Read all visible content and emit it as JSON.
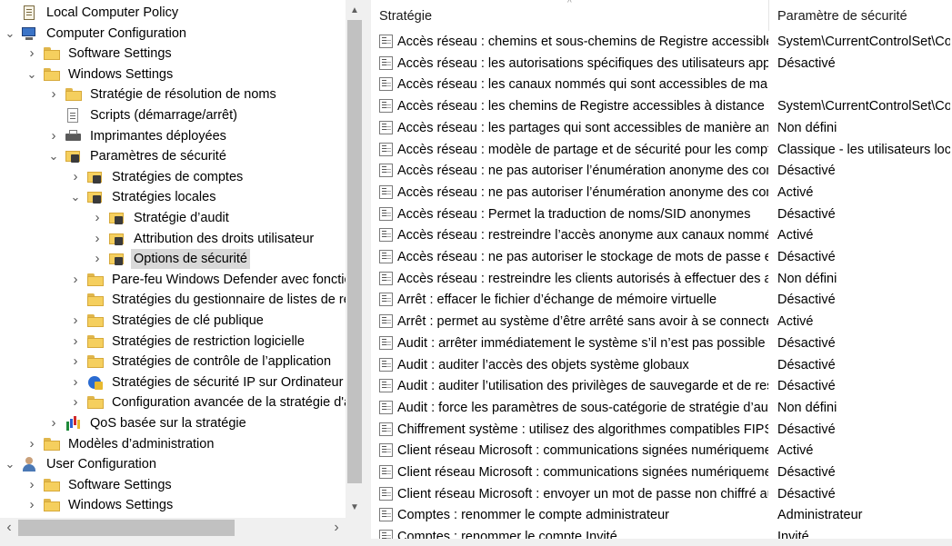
{
  "tree": {
    "nodes": [
      {
        "label": "Local Computer Policy",
        "icon": "policy-icon",
        "level": 0,
        "expander": ""
      },
      {
        "label": "Computer Configuration",
        "icon": "computer-icon",
        "level": 0,
        "expander": "down"
      },
      {
        "label": "Software Settings",
        "icon": "folder-icon",
        "level": 1,
        "expander": "right"
      },
      {
        "label": "Windows Settings",
        "icon": "folder-icon",
        "level": 1,
        "expander": "down"
      },
      {
        "label": "Stratégie de résolution de noms",
        "icon": "folder-icon",
        "level": 2,
        "expander": "right"
      },
      {
        "label": "Scripts (démarrage/arrêt)",
        "icon": "script-icon",
        "level": 2,
        "expander": ""
      },
      {
        "label": "Imprimantes déployées",
        "icon": "printer-icon",
        "level": 2,
        "expander": "right"
      },
      {
        "label": "Paramètres de sécurité",
        "icon": "security-icon",
        "level": 2,
        "expander": "down"
      },
      {
        "label": "Stratégies de comptes",
        "icon": "security-folder-icon",
        "level": 3,
        "expander": "right"
      },
      {
        "label": "Stratégies locales",
        "icon": "security-folder-icon",
        "level": 3,
        "expander": "down"
      },
      {
        "label": "Stratégie d’audit",
        "icon": "security-folder-icon",
        "level": 4,
        "expander": "right"
      },
      {
        "label": "Attribution des droits utilisateur",
        "icon": "security-folder-icon",
        "level": 4,
        "expander": "right"
      },
      {
        "label": "Options de sécurité",
        "icon": "security-folder-icon",
        "level": 4,
        "expander": "right",
        "selected": true
      },
      {
        "label": "Pare-feu Windows Defender avec fonctionnalités",
        "icon": "folder-icon",
        "level": 3,
        "expander": "right"
      },
      {
        "label": "Stratégies du gestionnaire de listes de réseaux",
        "icon": "folder-icon",
        "level": 3,
        "expander": ""
      },
      {
        "label": "Stratégies de clé publique",
        "icon": "folder-icon",
        "level": 3,
        "expander": "right"
      },
      {
        "label": "Stratégies de restriction logicielle",
        "icon": "folder-icon",
        "level": 3,
        "expander": "right"
      },
      {
        "label": "Stratégies de contrôle de l’application",
        "icon": "folder-icon",
        "level": 3,
        "expander": "right"
      },
      {
        "label": "Stratégies de sécurité IP sur Ordinateur local",
        "icon": "ipsec-icon",
        "level": 3,
        "expander": "right"
      },
      {
        "label": "Configuration avancée de la stratégie d'audit",
        "icon": "folder-icon",
        "level": 3,
        "expander": "right"
      },
      {
        "label": "QoS basée sur la stratégie",
        "icon": "qos-icon",
        "level": 2,
        "expander": "right"
      },
      {
        "label": "Modèles d’administration",
        "icon": "folder-icon",
        "level": 1,
        "expander": "right"
      },
      {
        "label": "User Configuration",
        "icon": "user-icon",
        "level": 0,
        "expander": "down"
      },
      {
        "label": "Software Settings",
        "icon": "folder-icon",
        "level": 1,
        "expander": "right"
      },
      {
        "label": "Windows Settings",
        "icon": "folder-icon",
        "level": 1,
        "expander": "right"
      }
    ]
  },
  "list": {
    "header_policy": "Stratégie",
    "header_setting": "Paramètre de sécurité",
    "rows": [
      {
        "policy": "Accès réseau : chemins et sous-chemins de Registre accessibles à distance",
        "setting": "System\\CurrentControlSet\\Control\\Print\\Printers"
      },
      {
        "policy": "Accès réseau : les autorisations spécifiques des utilisateurs appartenant au groupe Tout le monde",
        "setting": "Désactivé"
      },
      {
        "policy": "Accès réseau : les canaux nommés qui sont accessibles de manière anonyme",
        "setting": ""
      },
      {
        "policy": "Accès réseau : les chemins de Registre accessibles à distance",
        "setting": "System\\CurrentControlSet\\Control\\ProductOptions"
      },
      {
        "policy": "Accès réseau : les partages qui sont accessibles de manière anonyme",
        "setting": "Non défini"
      },
      {
        "policy": "Accès réseau : modèle de partage et de sécurité pour les comptes locaux",
        "setting": "Classique - les utilisateurs locaux s'authentifient eux-mêmes"
      },
      {
        "policy": "Accès réseau : ne pas autoriser l’énumération anonyme des comptes SAM",
        "setting": "Désactivé"
      },
      {
        "policy": "Accès réseau : ne pas autoriser l’énumération anonyme des comptes et partages SAM",
        "setting": "Activé"
      },
      {
        "policy": "Accès réseau : Permet la traduction de noms/SID anonymes",
        "setting": "Désactivé"
      },
      {
        "policy": "Accès réseau : restreindre l’accès anonyme aux canaux nommés et aux partages",
        "setting": "Activé"
      },
      {
        "policy": "Accès réseau : ne pas autoriser le stockage de mots de passe et d'informations d'identification",
        "setting": "Désactivé"
      },
      {
        "policy": "Accès réseau : restreindre les clients autorisés à effectuer des appels à distance à SAM",
        "setting": "Non défini"
      },
      {
        "policy": "Arrêt : effacer le fichier d’échange de mémoire virtuelle",
        "setting": "Désactivé"
      },
      {
        "policy": "Arrêt : permet au système d’être arrêté sans avoir à se connecter",
        "setting": "Activé"
      },
      {
        "policy": "Audit : arrêter immédiatement le système s’il n’est pas possible de se connecter aux audits de sécurité",
        "setting": "Désactivé"
      },
      {
        "policy": "Audit : auditer l’accès des objets système globaux",
        "setting": "Désactivé"
      },
      {
        "policy": "Audit : auditer l’utilisation des privilèges de sauvegarde et de restauration",
        "setting": "Désactivé"
      },
      {
        "policy": "Audit : force les paramètres de sous-catégorie de stratégie d’audit",
        "setting": "Non défini"
      },
      {
        "policy": "Chiffrement système : utilisez des algorithmes compatibles FIPS",
        "setting": "Désactivé"
      },
      {
        "policy": "Client réseau Microsoft : communications signées numériquement (toujours)",
        "setting": "Activé"
      },
      {
        "policy": "Client réseau Microsoft : communications signées numériquement (lorsque le serveur l'accepte)",
        "setting": "Désactivé"
      },
      {
        "policy": "Client réseau Microsoft : envoyer un mot de passe non chiffré aux serveurs SMB tiers",
        "setting": "Désactivé"
      },
      {
        "policy": "Comptes : renommer le compte administrateur",
        "setting": "Administrateur"
      },
      {
        "policy": "Comptes : renommer le compte Invité",
        "setting": "Invité"
      }
    ]
  },
  "glyphs": {
    "expand_right": "›",
    "expand_down": "⌄",
    "scroll_up": "▲",
    "scroll_down": "▼",
    "scroll_left": "‹",
    "scroll_right": "›",
    "sort": "^"
  }
}
